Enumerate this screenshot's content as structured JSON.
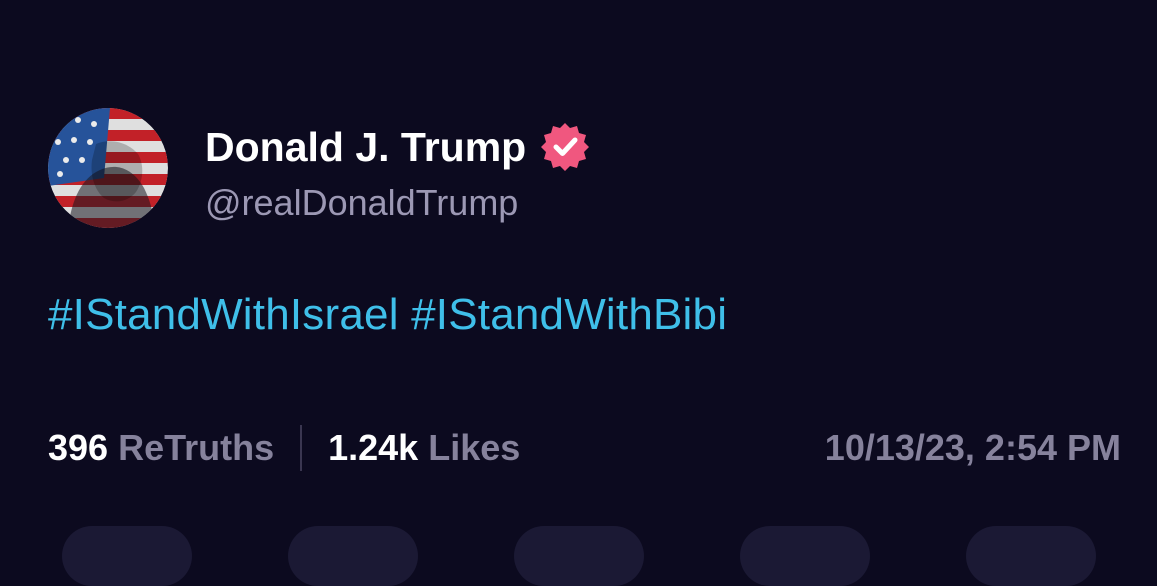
{
  "post": {
    "author": {
      "display_name": "Donald J. Trump",
      "handle": "@realDonaldTrump",
      "verified_icon": "verified-badge-icon",
      "verified_color": "#f0577f"
    },
    "hashtags": [
      "#IStandWithIsrael",
      "#IStandWithBibi"
    ],
    "stats": {
      "retruths_count": "396",
      "retruths_label": "ReTruths",
      "likes_count": "1.24k",
      "likes_label": "Likes"
    },
    "timestamp": "10/13/23, 2:54 PM"
  },
  "colors": {
    "background": "#0c0a1f",
    "hashtag": "#3fbfe9",
    "muted_text": "#86829c"
  }
}
